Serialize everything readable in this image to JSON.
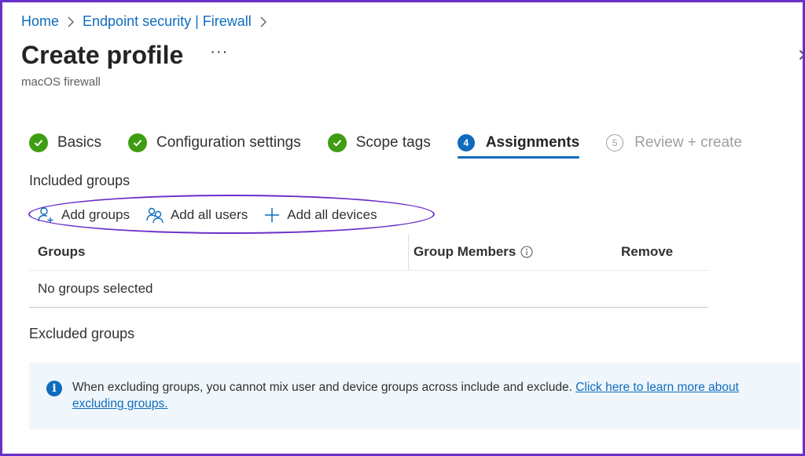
{
  "breadcrumb": {
    "items": [
      "Home",
      "Endpoint security | Firewall"
    ],
    "separator": ">"
  },
  "header": {
    "title": "Create profile",
    "more_label": "···",
    "subtitle": "macOS firewall"
  },
  "wizard": {
    "steps": [
      {
        "label": "Basics",
        "state": "complete"
      },
      {
        "label": "Configuration settings",
        "state": "complete"
      },
      {
        "label": "Scope tags",
        "state": "complete"
      },
      {
        "label": "Assignments",
        "state": "active",
        "number": "4"
      },
      {
        "label": "Review + create",
        "state": "pending",
        "number": "5"
      }
    ]
  },
  "included": {
    "title": "Included groups",
    "toolbar": {
      "add_groups": "Add groups",
      "add_all_users": "Add all users",
      "add_all_devices": "Add all devices"
    },
    "table": {
      "columns": [
        "Groups",
        "Group Members",
        "Remove"
      ],
      "empty_text": "No groups selected"
    }
  },
  "excluded": {
    "title": "Excluded groups"
  },
  "info": {
    "message": "When excluding groups, you cannot mix user and device groups across include and exclude. ",
    "link_text": "Click here to learn more about excluding groups."
  },
  "colors": {
    "accent": "#0f6cbd",
    "success": "#3f9d13",
    "highlight": "#6b2fc9",
    "info_background": "#eff6fc"
  }
}
